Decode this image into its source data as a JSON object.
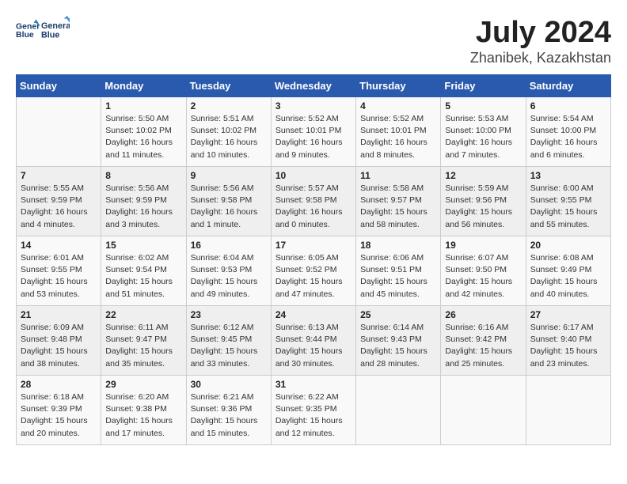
{
  "header": {
    "logo_line1": "General",
    "logo_line2": "Blue",
    "month": "July 2024",
    "location": "Zhanibek, Kazakhstan"
  },
  "weekdays": [
    "Sunday",
    "Monday",
    "Tuesday",
    "Wednesday",
    "Thursday",
    "Friday",
    "Saturday"
  ],
  "weeks": [
    [
      {
        "day": "",
        "info": ""
      },
      {
        "day": "1",
        "info": "Sunrise: 5:50 AM\nSunset: 10:02 PM\nDaylight: 16 hours\nand 11 minutes."
      },
      {
        "day": "2",
        "info": "Sunrise: 5:51 AM\nSunset: 10:02 PM\nDaylight: 16 hours\nand 10 minutes."
      },
      {
        "day": "3",
        "info": "Sunrise: 5:52 AM\nSunset: 10:01 PM\nDaylight: 16 hours\nand 9 minutes."
      },
      {
        "day": "4",
        "info": "Sunrise: 5:52 AM\nSunset: 10:01 PM\nDaylight: 16 hours\nand 8 minutes."
      },
      {
        "day": "5",
        "info": "Sunrise: 5:53 AM\nSunset: 10:00 PM\nDaylight: 16 hours\nand 7 minutes."
      },
      {
        "day": "6",
        "info": "Sunrise: 5:54 AM\nSunset: 10:00 PM\nDaylight: 16 hours\nand 6 minutes."
      }
    ],
    [
      {
        "day": "7",
        "info": "Sunrise: 5:55 AM\nSunset: 9:59 PM\nDaylight: 16 hours\nand 4 minutes."
      },
      {
        "day": "8",
        "info": "Sunrise: 5:56 AM\nSunset: 9:59 PM\nDaylight: 16 hours\nand 3 minutes."
      },
      {
        "day": "9",
        "info": "Sunrise: 5:56 AM\nSunset: 9:58 PM\nDaylight: 16 hours\nand 1 minute."
      },
      {
        "day": "10",
        "info": "Sunrise: 5:57 AM\nSunset: 9:58 PM\nDaylight: 16 hours\nand 0 minutes."
      },
      {
        "day": "11",
        "info": "Sunrise: 5:58 AM\nSunset: 9:57 PM\nDaylight: 15 hours\nand 58 minutes."
      },
      {
        "day": "12",
        "info": "Sunrise: 5:59 AM\nSunset: 9:56 PM\nDaylight: 15 hours\nand 56 minutes."
      },
      {
        "day": "13",
        "info": "Sunrise: 6:00 AM\nSunset: 9:55 PM\nDaylight: 15 hours\nand 55 minutes."
      }
    ],
    [
      {
        "day": "14",
        "info": "Sunrise: 6:01 AM\nSunset: 9:55 PM\nDaylight: 15 hours\nand 53 minutes."
      },
      {
        "day": "15",
        "info": "Sunrise: 6:02 AM\nSunset: 9:54 PM\nDaylight: 15 hours\nand 51 minutes."
      },
      {
        "day": "16",
        "info": "Sunrise: 6:04 AM\nSunset: 9:53 PM\nDaylight: 15 hours\nand 49 minutes."
      },
      {
        "day": "17",
        "info": "Sunrise: 6:05 AM\nSunset: 9:52 PM\nDaylight: 15 hours\nand 47 minutes."
      },
      {
        "day": "18",
        "info": "Sunrise: 6:06 AM\nSunset: 9:51 PM\nDaylight: 15 hours\nand 45 minutes."
      },
      {
        "day": "19",
        "info": "Sunrise: 6:07 AM\nSunset: 9:50 PM\nDaylight: 15 hours\nand 42 minutes."
      },
      {
        "day": "20",
        "info": "Sunrise: 6:08 AM\nSunset: 9:49 PM\nDaylight: 15 hours\nand 40 minutes."
      }
    ],
    [
      {
        "day": "21",
        "info": "Sunrise: 6:09 AM\nSunset: 9:48 PM\nDaylight: 15 hours\nand 38 minutes."
      },
      {
        "day": "22",
        "info": "Sunrise: 6:11 AM\nSunset: 9:47 PM\nDaylight: 15 hours\nand 35 minutes."
      },
      {
        "day": "23",
        "info": "Sunrise: 6:12 AM\nSunset: 9:45 PM\nDaylight: 15 hours\nand 33 minutes."
      },
      {
        "day": "24",
        "info": "Sunrise: 6:13 AM\nSunset: 9:44 PM\nDaylight: 15 hours\nand 30 minutes."
      },
      {
        "day": "25",
        "info": "Sunrise: 6:14 AM\nSunset: 9:43 PM\nDaylight: 15 hours\nand 28 minutes."
      },
      {
        "day": "26",
        "info": "Sunrise: 6:16 AM\nSunset: 9:42 PM\nDaylight: 15 hours\nand 25 minutes."
      },
      {
        "day": "27",
        "info": "Sunrise: 6:17 AM\nSunset: 9:40 PM\nDaylight: 15 hours\nand 23 minutes."
      }
    ],
    [
      {
        "day": "28",
        "info": "Sunrise: 6:18 AM\nSunset: 9:39 PM\nDaylight: 15 hours\nand 20 minutes."
      },
      {
        "day": "29",
        "info": "Sunrise: 6:20 AM\nSunset: 9:38 PM\nDaylight: 15 hours\nand 17 minutes."
      },
      {
        "day": "30",
        "info": "Sunrise: 6:21 AM\nSunset: 9:36 PM\nDaylight: 15 hours\nand 15 minutes."
      },
      {
        "day": "31",
        "info": "Sunrise: 6:22 AM\nSunset: 9:35 PM\nDaylight: 15 hours\nand 12 minutes."
      },
      {
        "day": "",
        "info": ""
      },
      {
        "day": "",
        "info": ""
      },
      {
        "day": "",
        "info": ""
      }
    ]
  ]
}
